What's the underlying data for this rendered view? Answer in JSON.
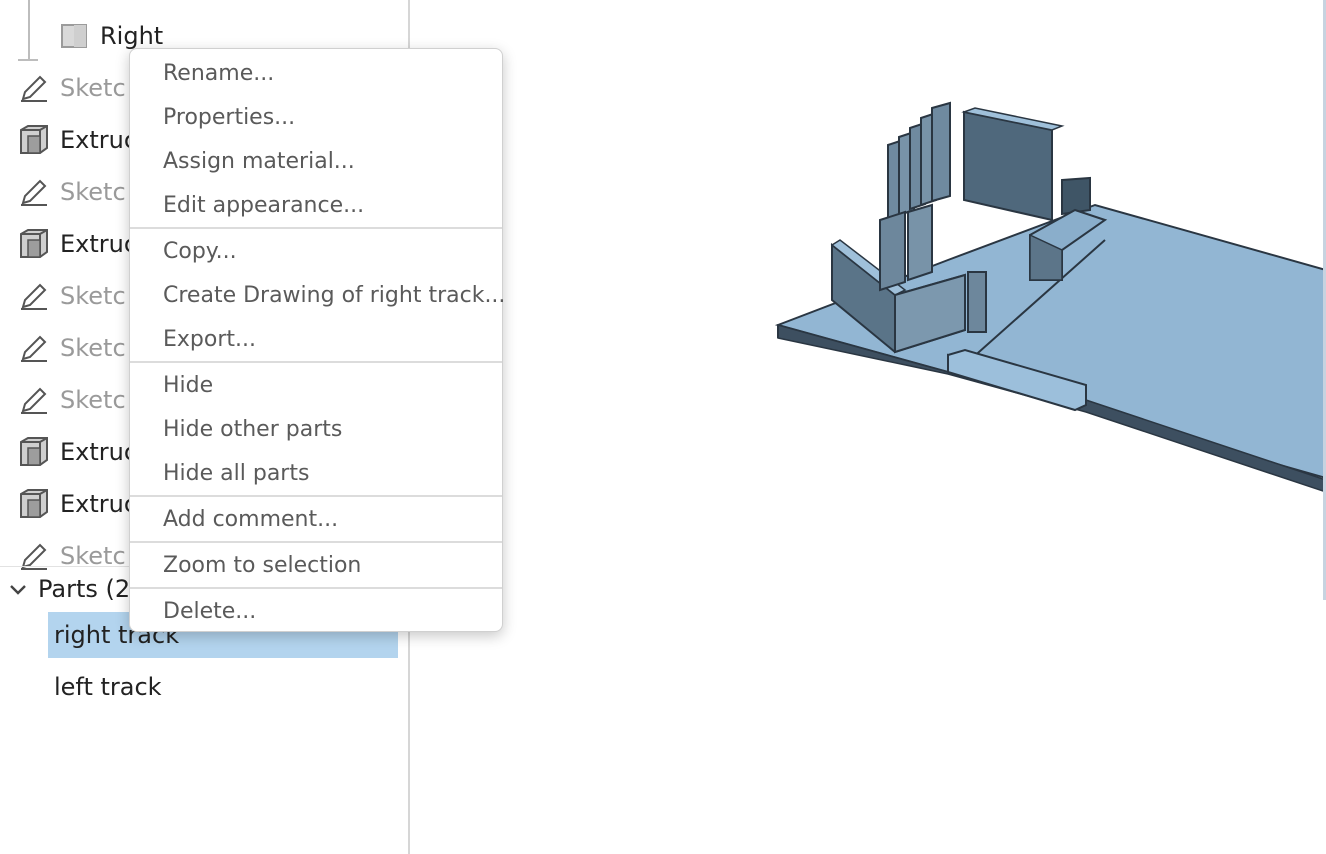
{
  "feature_tree": {
    "plane": {
      "label": "Right",
      "icon": "plane-icon"
    },
    "features": [
      {
        "label": "Sketc",
        "type": "sketch",
        "icon": "pencil-icon"
      },
      {
        "label": "Extruc",
        "type": "extrude",
        "icon": "extrude-icon"
      },
      {
        "label": "Sketc",
        "type": "sketch",
        "icon": "pencil-icon"
      },
      {
        "label": "Extruc",
        "type": "extrude",
        "icon": "extrude-icon"
      },
      {
        "label": "Sketc",
        "type": "sketch",
        "icon": "pencil-icon"
      },
      {
        "label": "Sketc",
        "type": "sketch",
        "icon": "pencil-icon"
      },
      {
        "label": "Sketc",
        "type": "sketch",
        "icon": "pencil-icon"
      },
      {
        "label": "Extruc",
        "type": "extrude",
        "icon": "extrude-icon"
      },
      {
        "label": "Extruc",
        "type": "extrude",
        "icon": "extrude-icon"
      },
      {
        "label": "Sketc",
        "type": "sketch",
        "icon": "pencil-icon"
      }
    ],
    "parts_header": "Parts (2",
    "parts": [
      {
        "label": "right track",
        "selected": true
      },
      {
        "label": "left track",
        "selected": false
      }
    ]
  },
  "context_menu": {
    "groups": [
      [
        "Rename...",
        "Properties...",
        "Assign material...",
        "Edit appearance..."
      ],
      [
        "Copy...",
        "Create Drawing of right track...",
        "Export..."
      ],
      [
        "Hide",
        "Hide other parts",
        "Hide all parts"
      ],
      [
        "Add comment..."
      ],
      [
        "Zoom to selection"
      ],
      [
        "Delete..."
      ]
    ]
  },
  "colors": {
    "selection": "#b3d4ee",
    "part_fill": "#8fb3d0",
    "part_dark": "#4c6478",
    "sketch_text": "#9a9a9a"
  }
}
